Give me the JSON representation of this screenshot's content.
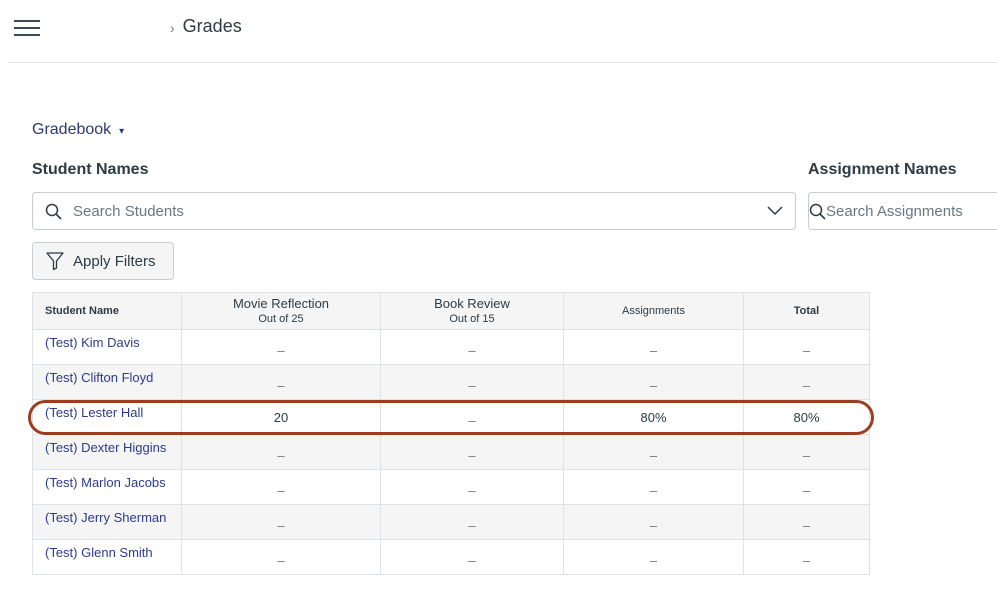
{
  "breadcrumb": {
    "separator": "›",
    "current": "Grades"
  },
  "gradebook_menu": {
    "label": "Gradebook",
    "caret": "▾"
  },
  "filters": {
    "students_label": "Student Names",
    "students_placeholder": "Search Students",
    "assignments_label": "Assignment Names",
    "assignments_placeholder": "Search Assignments",
    "apply_label": "Apply Filters"
  },
  "table": {
    "columns": [
      {
        "title": "Student Name",
        "subtitle": ""
      },
      {
        "title": "Movie Reflection",
        "subtitle": "Out of 25"
      },
      {
        "title": "Book Review",
        "subtitle": "Out of 15"
      },
      {
        "title": "Assignments",
        "subtitle": ""
      },
      {
        "title": "Total",
        "subtitle": ""
      }
    ],
    "rows": [
      {
        "name": "(Test) Kim Davis",
        "movie_reflection": "–",
        "book_review": "–",
        "assignments": "–",
        "total": "–"
      },
      {
        "name": "(Test) Clifton Floyd",
        "movie_reflection": "–",
        "book_review": "–",
        "assignments": "–",
        "total": "–"
      },
      {
        "name": "(Test) Lester Hall",
        "movie_reflection": "20",
        "book_review": "–",
        "assignments": "80%",
        "total": "80%"
      },
      {
        "name": "(Test) Dexter Higgins",
        "movie_reflection": "–",
        "book_review": "–",
        "assignments": "–",
        "total": "–"
      },
      {
        "name": "(Test) Marlon Jacobs",
        "movie_reflection": "–",
        "book_review": "–",
        "assignments": "–",
        "total": "–"
      },
      {
        "name": "(Test) Jerry Sherman",
        "movie_reflection": "–",
        "book_review": "–",
        "assignments": "–",
        "total": "–"
      },
      {
        "name": "(Test) Glenn Smith",
        "movie_reflection": "–",
        "book_review": "–",
        "assignments": "–",
        "total": "–"
      }
    ],
    "highlighted_row": 2
  },
  "colors": {
    "link": "#2d3b8a",
    "highlight_ring": "#9b3d1f",
    "header_bg": "#f5f5f5"
  },
  "icons": {
    "menu": "hamburger-icon",
    "search": "search-icon",
    "dropdown": "chevron-down-icon",
    "filter": "filter-icon"
  }
}
